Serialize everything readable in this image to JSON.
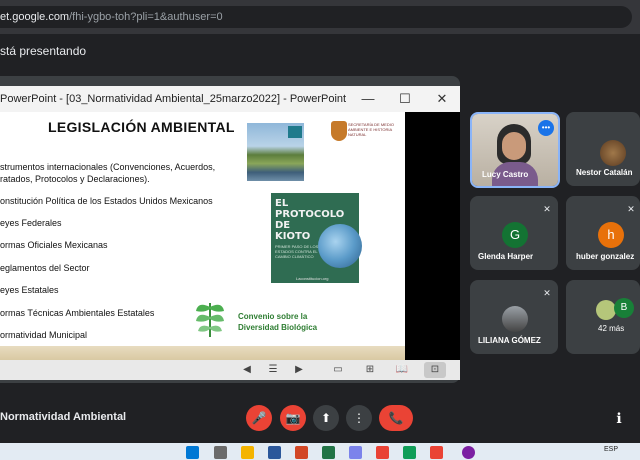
{
  "browser": {
    "url_domain": "et.google.com",
    "url_path": "/fhi-ygbo-toh?pli=1&authuser=0"
  },
  "presenting_text": "stá presentando",
  "powerpoint": {
    "window_title": "PowerPoint - [03_Normatividad Ambiental_25marzo2022] - PowerPoint",
    "minimize": "—",
    "maximize": "☐",
    "close": "✕"
  },
  "slide": {
    "title": "LEGISLACIÓN AMBIENTAL",
    "items": [
      "strumentos internacionales (Convenciones, Acuerdos,",
      "ratados, Protocolos y Declaraciones).",
      "onstitución Política de los Estados Unidos Mexicanos",
      "eyes Federales",
      "ormas Oficiales Mexicanas",
      "eglamentos del Sector",
      "eyes Estatales",
      "ormas Técnicas Ambientales Estatales",
      "ormatividad Municipal"
    ],
    "semarnat_text": "SECRETARÍA DE MEDIO AMBIENTE E HISTORIA NATURAL",
    "kioto_title": "EL PROTOCOLO DE KIOTO",
    "kioto_subtitle": "PRIMER PASO DE LOS ESTADOS CONTRA EL CAMBIO CLIMÁTICO",
    "kioto_url": "Laconstitucion.org",
    "convenio_text": "Convenio sobre la Diversidad Biológica"
  },
  "slideshow_controls": {
    "prev": "◀",
    "menu": "☰",
    "next": "▶",
    "view1": "▭",
    "view2": "⊞",
    "view3": "📖",
    "view4": "⊡"
  },
  "participants": [
    {
      "name": "Lucy Castro",
      "type": "video"
    },
    {
      "name": "Nestor Catalán",
      "type": "video"
    },
    {
      "name": "Glenda Harper",
      "initial": "G",
      "color": "#137333"
    },
    {
      "name": "huber gonzalez",
      "initial": "h",
      "color": "#e8710a"
    },
    {
      "name": "LILIANA GÓMEZ",
      "type": "photo"
    },
    {
      "name": "42 más",
      "initial": "B",
      "color": "#188038"
    }
  ],
  "meeting_title": "Normatividad Ambiental",
  "controls": {
    "mic": "🎤",
    "camera": "📷",
    "present": "⬆",
    "more": "⋮",
    "leave": "📞",
    "info": "ℹ"
  },
  "taskbar": {
    "lang": "ESP"
  },
  "colors": {
    "accent": "#8ab4f8",
    "danger": "#ea4335",
    "surface": "#3c4043",
    "background": "#202124"
  }
}
